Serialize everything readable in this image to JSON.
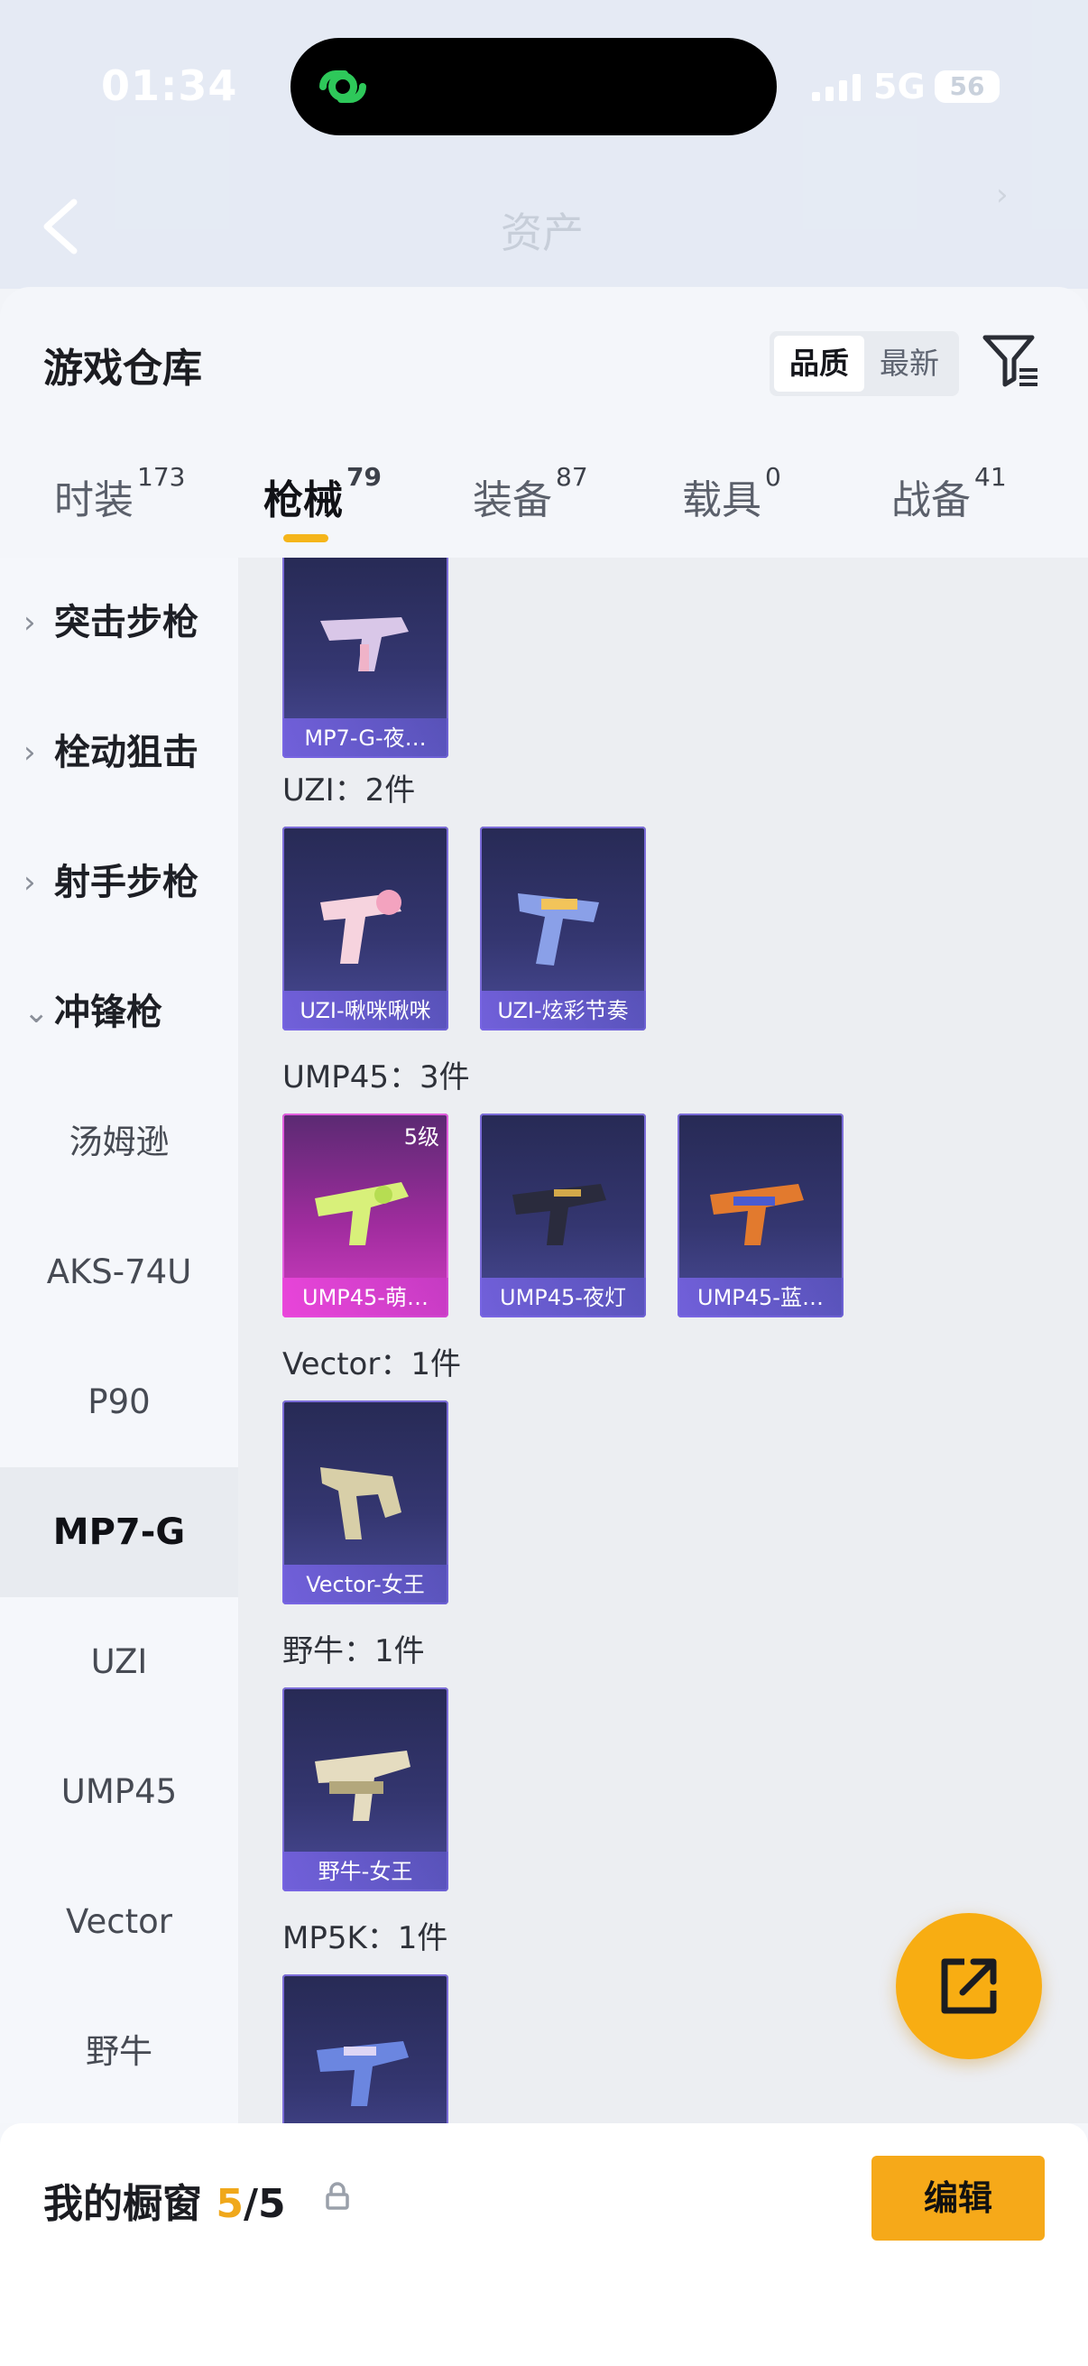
{
  "status_bar": {
    "time": "01:34",
    "network": "5G",
    "battery": "56"
  },
  "background_page": {
    "title": "资产"
  },
  "header": {
    "title": "游戏仓库",
    "sort_quality": "品质",
    "sort_newest": "最新"
  },
  "tabs": [
    {
      "label": "时装",
      "count": "173"
    },
    {
      "label": "枪械",
      "count": "79",
      "active": true
    },
    {
      "label": "装备",
      "count": "87"
    },
    {
      "label": "载具",
      "count": "0"
    },
    {
      "label": "战备",
      "count": "41"
    }
  ],
  "sidebar": {
    "groups": [
      {
        "label": "突击步枪",
        "chevron": "›"
      },
      {
        "label": "栓动狙击",
        "chevron": "›"
      },
      {
        "label": "射手步枪",
        "chevron": "›"
      },
      {
        "label": "冲锋枪",
        "chevron": "⌄",
        "expanded": true
      }
    ],
    "subitems": [
      "汤姆逊",
      "AKS-74U",
      "P90",
      "MP7-G",
      "UZI",
      "UMP45",
      "Vector",
      "野牛"
    ],
    "selected": "MP7-G"
  },
  "content": {
    "sections": [
      {
        "label": "",
        "items": [
          {
            "name": "MP7-G-夜…",
            "rarity": "purple"
          }
        ]
      },
      {
        "label": "UZI：2件",
        "items": [
          {
            "name": "UZI-啾咪啾咪",
            "rarity": "purple"
          },
          {
            "name": "UZI-炫彩节奏",
            "rarity": "purple"
          }
        ]
      },
      {
        "label": "UMP45：3件",
        "items": [
          {
            "name": "UMP45-萌…",
            "rarity": "pink",
            "level": "5级"
          },
          {
            "name": "UMP45-夜灯",
            "rarity": "purple"
          },
          {
            "name": "UMP45-蓝…",
            "rarity": "purple"
          }
        ]
      },
      {
        "label": "Vector：1件",
        "items": [
          {
            "name": "Vector-女王",
            "rarity": "purple"
          }
        ]
      },
      {
        "label": "野牛：1件",
        "items": [
          {
            "name": "野牛-女王",
            "rarity": "purple"
          }
        ]
      },
      {
        "label": "MP5K：1件",
        "items": [
          {
            "name": "",
            "rarity": "purple"
          }
        ]
      }
    ]
  },
  "bottom_bar": {
    "title": "我的橱窗",
    "count": "5",
    "total": "/5",
    "edit_label": "编辑"
  },
  "icons": {
    "filter": "filter-icon",
    "back": "back-arrow-icon",
    "share": "share-icon",
    "lock": "lock-icon"
  },
  "colors": {
    "accent": "#f6a919",
    "card_purple": "#343670",
    "card_pink": "#a02c9e"
  }
}
